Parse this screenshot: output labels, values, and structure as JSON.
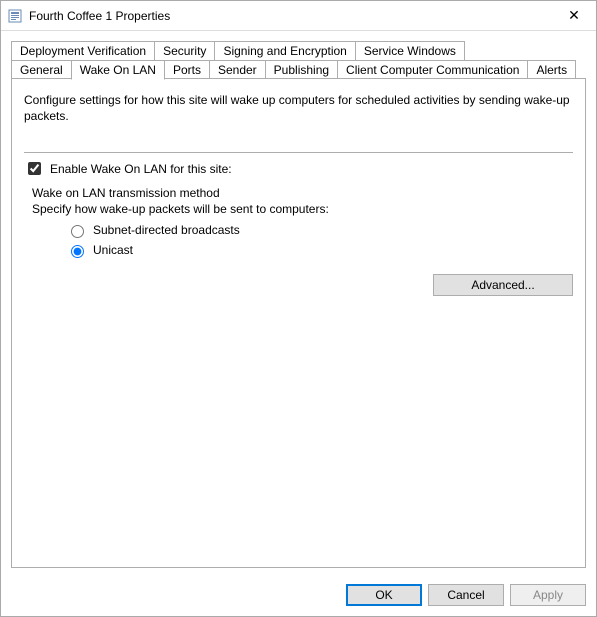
{
  "window": {
    "title": "Fourth Coffee 1 Properties",
    "close_label": "✕"
  },
  "tabs": {
    "row1": [
      "Deployment Verification",
      "Security",
      "Signing and Encryption",
      "Service Windows"
    ],
    "row2": [
      "General",
      "Wake On LAN",
      "Ports",
      "Sender",
      "Publishing",
      "Client Computer Communication",
      "Alerts"
    ],
    "active": "Wake On LAN"
  },
  "panel": {
    "description": "Configure settings for how this site will wake up computers for scheduled activities by sending wake-up packets.",
    "enable_label": "Enable Wake On LAN for this site:",
    "enable_checked": true,
    "group_title": "Wake on LAN transmission method",
    "group_hint": "Specify how wake-up packets will be sent to computers:",
    "radio_subnet": "Subnet-directed broadcasts",
    "radio_unicast": "Unicast",
    "radio_selected": "unicast",
    "advanced": "Advanced..."
  },
  "buttons": {
    "ok": "OK",
    "cancel": "Cancel",
    "apply": "Apply"
  }
}
